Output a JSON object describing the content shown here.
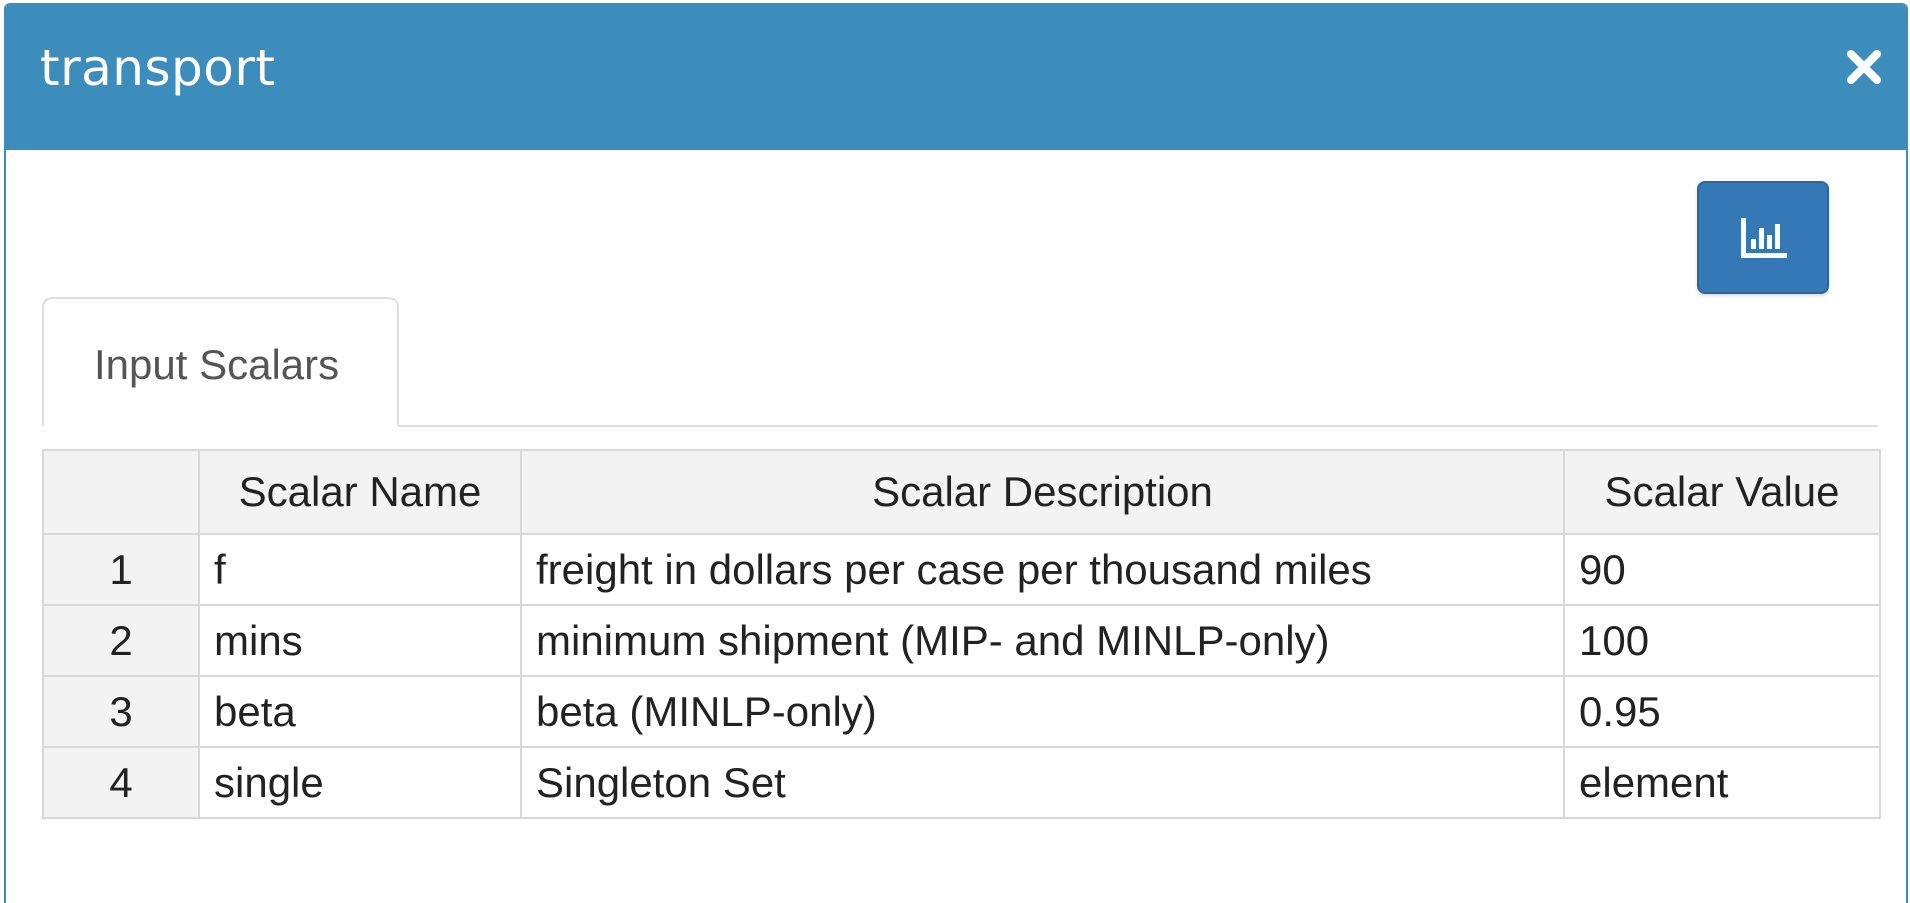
{
  "dialog": {
    "title": "transport",
    "close_icon": "close-icon",
    "chart_button_icon": "bar-chart-icon",
    "header_color": "#3d8dbc",
    "button_color": "#3478b5"
  },
  "tabs": [
    {
      "label": "Input Scalars",
      "active": true
    }
  ],
  "table": {
    "columns": [
      "",
      "Scalar Name",
      "Scalar Description",
      "Scalar Value"
    ],
    "rows": [
      {
        "index": "1",
        "name": "f",
        "description": "freight in dollars per case per thousand miles",
        "value": "90"
      },
      {
        "index": "2",
        "name": "mins",
        "description": "minimum shipment (MIP- and MINLP-only)",
        "value": "100"
      },
      {
        "index": "3",
        "name": "beta",
        "description": "beta (MINLP-only)",
        "value": "0.95"
      },
      {
        "index": "4",
        "name": "single",
        "description": "Singleton Set",
        "value": "element"
      }
    ]
  }
}
